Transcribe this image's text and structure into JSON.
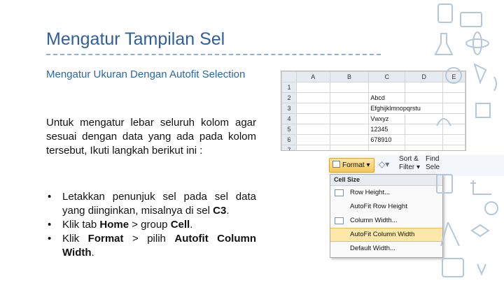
{
  "slide": {
    "title": "Mengatur Tampilan Sel",
    "subheading": "Mengatur Ukuran Dengan Autofit Selection",
    "paragraph": "Untuk mengatur lebar seluruh kolom agar sesuai dengan data yang ada pada kolom tersebut, Ikuti langkah berikut ini :",
    "bullet_marker": "•",
    "bullets": [
      {
        "text": "Letakkan penunjuk sel pada sel data yang diinginkan, misalnya di sel ",
        "bold": "C3",
        "tail": "."
      },
      {
        "pre": "Klik tab ",
        "b1": "Home",
        "mid": " > group ",
        "b2": "Cell",
        "tail": "."
      },
      {
        "pre": "Klik ",
        "b1": "Format",
        "mid": " > pilih ",
        "b2": "Autofit Column Width",
        "tail": "."
      }
    ]
  },
  "spreadsheet": {
    "columns": [
      "A",
      "B",
      "C",
      "D",
      "E"
    ],
    "rows": [
      {
        "num": "1",
        "c": ""
      },
      {
        "num": "2",
        "c": "Abcd"
      },
      {
        "num": "3",
        "c": "Efghijklmnopqrstu"
      },
      {
        "num": "4",
        "c": "Vwxyz"
      },
      {
        "num": "5",
        "c": "12345"
      },
      {
        "num": "6",
        "c": "678910"
      },
      {
        "num": "7",
        "c": ""
      }
    ]
  },
  "ribbon": {
    "format_label": "Format",
    "format_arrow": "▾",
    "sort_label": "Sort &",
    "filter_label": "Filter",
    "find_label": "Find",
    "select_label": "Sele"
  },
  "format_menu": {
    "header": "Cell Size",
    "items": [
      "Row Height...",
      "AutoFit Row Height",
      "Column Width...",
      "AutoFit Column Width",
      "Default Width..."
    ],
    "active_item": "AutoFit Column Width"
  },
  "colors": {
    "title": "#2f5f9e",
    "subheading": "#2a66b0",
    "menu_highlight": "#fde7a9",
    "doodle": "#b5c7dd"
  }
}
